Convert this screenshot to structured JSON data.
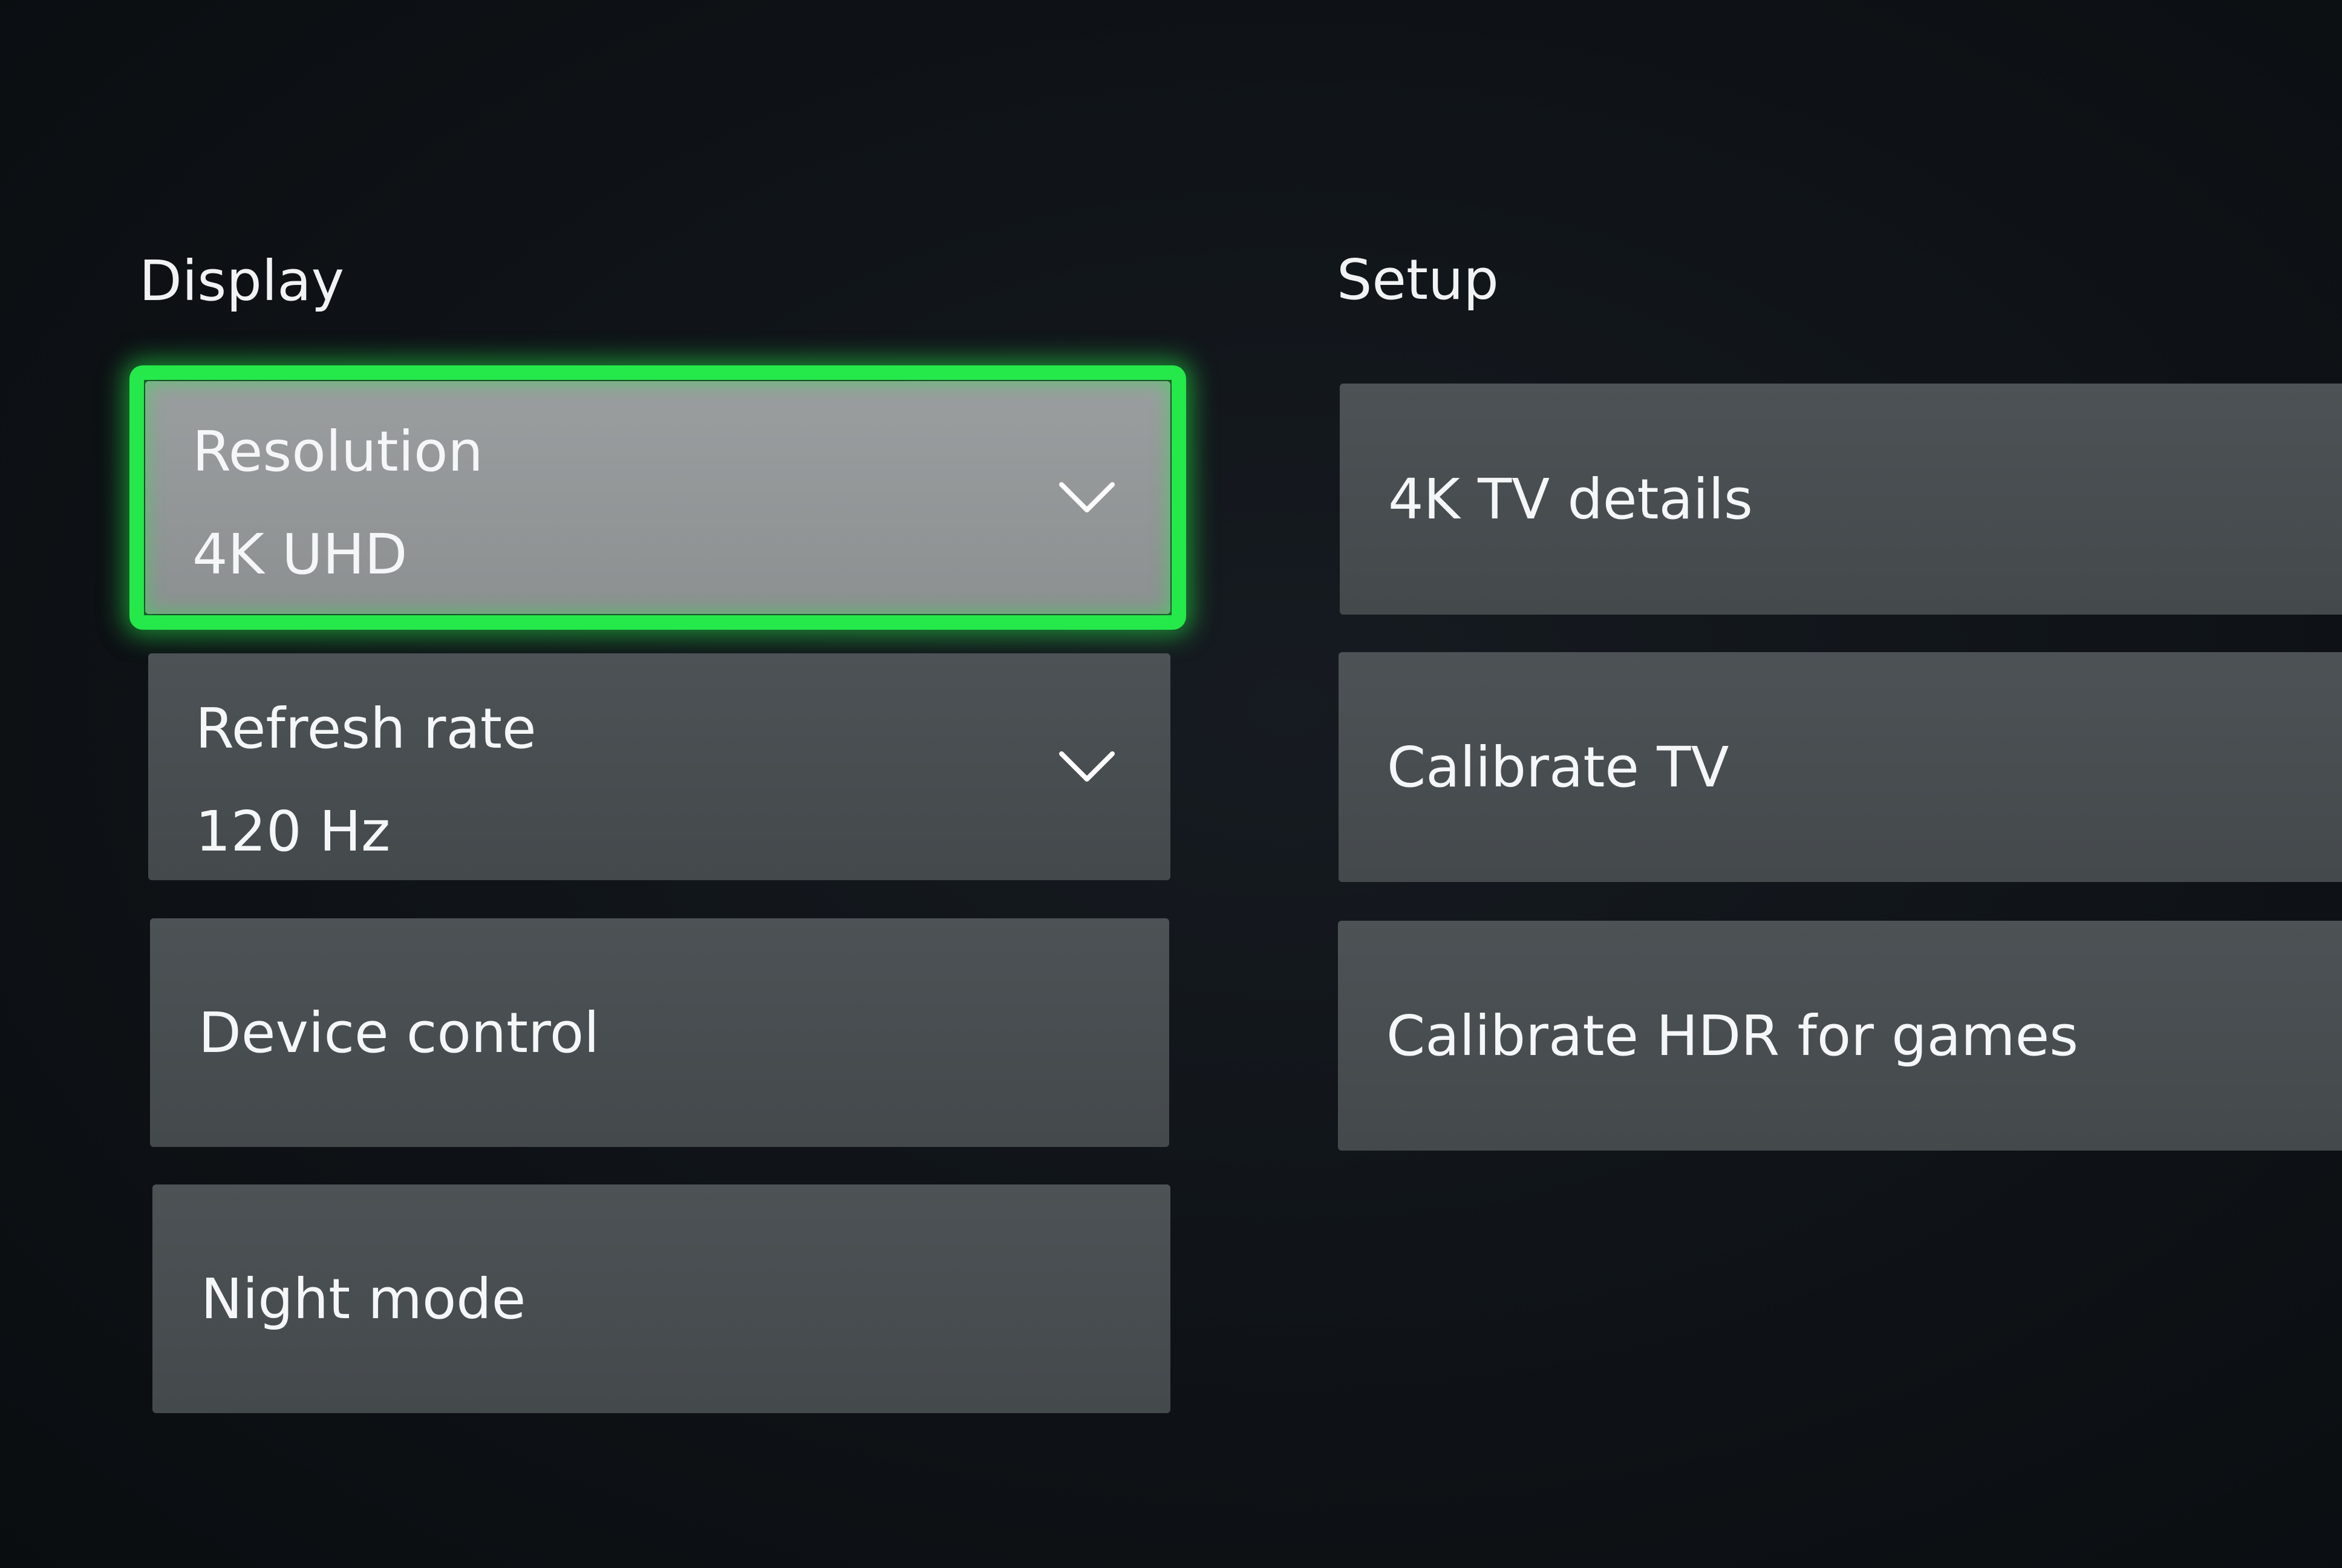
{
  "display_section": {
    "title": "Display",
    "resolution": {
      "label": "Resolution",
      "value": "4K UHD",
      "focused": true
    },
    "refresh_rate": {
      "label": "Refresh rate",
      "value": "120 Hz"
    },
    "device_control": {
      "label": "Device control"
    },
    "night_mode": {
      "label": "Night mode"
    }
  },
  "setup_section": {
    "title": "Setup",
    "tv_details": {
      "label": "4K TV details"
    },
    "calibrate_tv": {
      "label": "Calibrate TV"
    },
    "calibrate_hdr": {
      "label": "Calibrate HDR for games"
    }
  },
  "icons": {
    "dropdown": "chevron-down-icon"
  },
  "colors": {
    "focus": "#25e84a",
    "tile": "#484d50",
    "tile_focused": "#949899",
    "background": "#0e1216",
    "text": "#f4f6f7"
  }
}
